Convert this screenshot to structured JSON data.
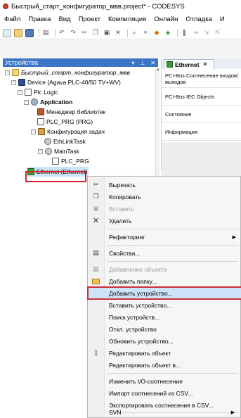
{
  "window": {
    "title": "Быстрый_старт_конфигуратор_мвв.project* - CODESYS"
  },
  "menubar": [
    "Файл",
    "Правка",
    "Вид",
    "Проект",
    "Компиляция",
    "Онлайн",
    "Отладка",
    "И"
  ],
  "devices_panel": {
    "title": "Устройства",
    "tree": [
      {
        "label": "Быстрый_старт_конфигуратор_мвв",
        "icon": "project-icon",
        "italic": true
      },
      {
        "label": "Device (Agava PLC-40/50 TV+WV)",
        "icon": "device-icon"
      },
      {
        "label": "Plc Logic",
        "icon": "plc-logic-icon"
      },
      {
        "label": "Application",
        "icon": "application-icon",
        "bold": true
      },
      {
        "label": "Менеджер библиотек",
        "icon": "library-manager-icon"
      },
      {
        "label": "PLC_PRG (PRG)",
        "icon": "pou-icon"
      },
      {
        "label": "Конфигурация задач",
        "icon": "task-config-icon"
      },
      {
        "label": "EthLinkTask",
        "icon": "task-icon"
      },
      {
        "label": "MainTask",
        "icon": "task-icon"
      },
      {
        "label": "PLC_PRG",
        "icon": "pou-call-icon"
      },
      {
        "label": "Ethernet (Ethernet)",
        "icon": "ethernet-icon"
      }
    ]
  },
  "editor": {
    "tab_label": "Ethernet",
    "side_tabs": [
      "PCI-Bus Соотнесение входов/выходов",
      "PCI-Bus IEC Objects",
      "Состояние",
      "Информация"
    ]
  },
  "context_menu": {
    "items": [
      {
        "label": "Вырезать",
        "icon": "cut-icon"
      },
      {
        "label": "Копировать",
        "icon": "copy-icon"
      },
      {
        "label": "Вставить",
        "icon": "paste-icon",
        "disabled": true
      },
      {
        "label": "Удалить",
        "icon": "delete-icon"
      },
      {
        "label": "Рефакторинг",
        "submenu": true
      },
      {
        "label": "Свойства...",
        "icon": "properties-icon"
      },
      {
        "label": "Добавление объекта",
        "icon": "add-object-icon",
        "disabled": true
      },
      {
        "label": "Добавить папку...",
        "icon": "folder-icon"
      },
      {
        "label": "Добавить устройство...",
        "highlighted": true
      },
      {
        "label": "Вставить устройство..."
      },
      {
        "label": "Поиск устройств..."
      },
      {
        "label": "Откл. устройство"
      },
      {
        "label": "Обновить устройство..."
      },
      {
        "label": "Редактировать объект",
        "icon": "edit-object-icon"
      },
      {
        "label": "Редактировать объект в..."
      },
      {
        "label": "Изменить I/O-соотнесение"
      },
      {
        "label": "Импорт соотнесений из CSV..."
      },
      {
        "label": "Экспортировать соотнесения в CSV..."
      },
      {
        "label": "SVN",
        "submenu": true
      }
    ]
  },
  "colors": {
    "accent": "#3b76c7",
    "highlight": "#cde3f7",
    "annotation_red": "#d2232b"
  }
}
